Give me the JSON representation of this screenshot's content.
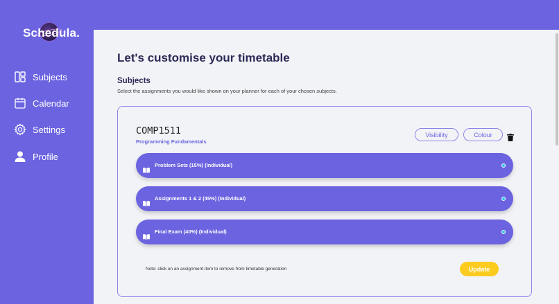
{
  "app": {
    "logo_text": "Schedula."
  },
  "sidebar": {
    "items": [
      {
        "label": "Subjects",
        "icon": "subjects-icon"
      },
      {
        "label": "Calendar",
        "icon": "calendar-icon"
      },
      {
        "label": "Settings",
        "icon": "gear-icon"
      },
      {
        "label": "Profile",
        "icon": "user-icon"
      }
    ]
  },
  "main": {
    "title": "Let's customise your timetable",
    "section_title": "Subjects",
    "section_subtitle": "Select the assignments you would like shown on your planner for each of your chosen subjects."
  },
  "subject": {
    "code": "COMP1511",
    "name": "Programming Fundamentals",
    "visibility_label": "Visibility",
    "colour_label": "Colour",
    "assignments": [
      {
        "label": "Problem Sets (15%) (Individual)"
      },
      {
        "label": "Assignments 1 & 2 (45%) (Individual)"
      },
      {
        "label": "Final Exam (40%) (Individual)"
      }
    ],
    "note": "Note: click on an assignment item to remove from timetable generation",
    "update_label": "Update"
  },
  "colors": {
    "primary": "#6b63e0",
    "background": "#f2f3f7",
    "accent": "#fccb1f",
    "dot": "#2ec5e8"
  }
}
